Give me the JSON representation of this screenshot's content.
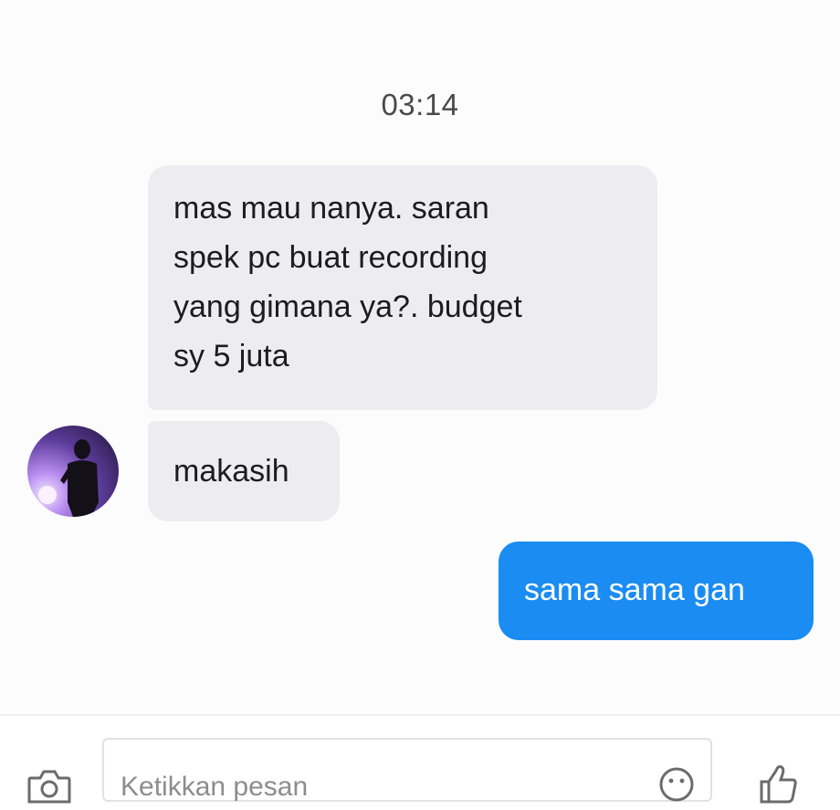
{
  "conversation": {
    "timestamp": "03:14",
    "messages": [
      {
        "direction": "incoming",
        "lines": [
          "mas mau nanya. saran",
          "spek pc buat recording",
          "yang gimana ya?. budget",
          "sy 5 juta"
        ]
      },
      {
        "direction": "incoming",
        "text": "makasih"
      },
      {
        "direction": "outgoing",
        "text": "sama sama gan"
      }
    ]
  },
  "composer": {
    "placeholder": "Ketikkan pesan",
    "icons": {
      "camera": "camera-icon",
      "emoji": "emoji-icon",
      "like": "thumbs-up-icon"
    }
  },
  "colors": {
    "incoming_bubble": "#ececf1",
    "outgoing_bubble": "#1a8cf2",
    "outgoing_text": "#ffffff"
  }
}
